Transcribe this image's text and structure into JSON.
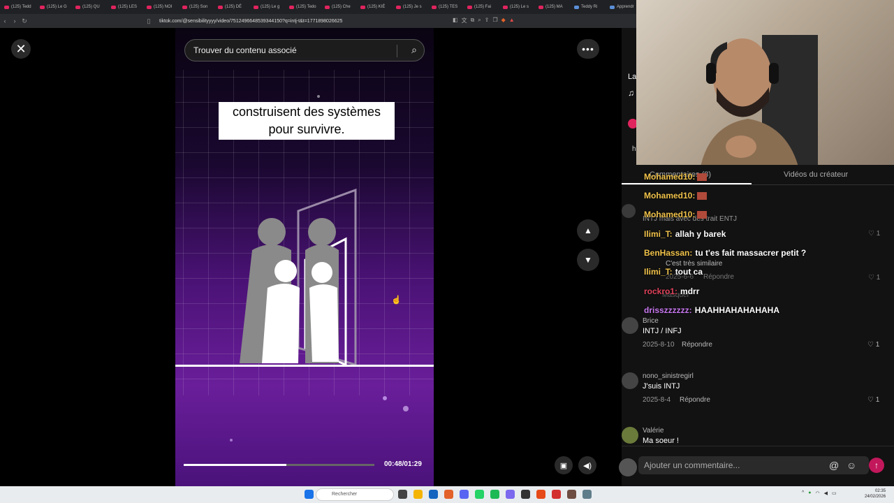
{
  "browser": {
    "tabs": [
      "(125) Tedd",
      "(125) Le G",
      "(125) QU",
      "(125) LES",
      "(125) NOI",
      "(125) Son",
      "(125) DÉ",
      "(125) Le g",
      "(125) Tedo",
      "(125) Che",
      "(125) KIÉ",
      "(125) Je s",
      "(125) TES",
      "(125) Fai",
      "(125) Le s",
      "(125) MA",
      "Teddy Ri",
      "Apprendr"
    ],
    "url": "tiktok.com/@sensibilityyyy/video/7512496648539344150?q=intj-t&t=1771898026625"
  },
  "video": {
    "search_placeholder": "Trouver du contenu associé",
    "caption": "construisent des systèmes pour survivre.",
    "progress": 0.54,
    "time": "00:48/01:29"
  },
  "comments_panel": {
    "tab_comments": "Commentaires (8)",
    "tab_creator": "Vidéos du créateur",
    "comments": [
      {
        "name": "Brice",
        "text": "INTJ / INFJ",
        "date": "2025-8-10",
        "reply": "Répondre",
        "likes": "1"
      },
      {
        "name": "nono_sinistregirl",
        "text": "J'suis INTJ",
        "date": "2025-8-4",
        "reply": "Répondre",
        "likes": "1"
      },
      {
        "name": "Valérie",
        "text": "Ma soeur !"
      }
    ],
    "faded": {
      "t1": "INTJ mais avec des trait ENTJ",
      "t2": "C'est très similaire",
      "t3": "2025-6-6",
      "t4": "Répondre",
      "t5": "Masquer",
      "like": "1"
    },
    "input_placeholder": "Ajouter un commentaire...",
    "side_snippets": {
      "a": "La",
      "b": "h"
    }
  },
  "stream_chat": [
    {
      "user": "Mohamed10:",
      "text": "",
      "color": "#f0c24a"
    },
    {
      "user": "Mohamed10:",
      "text": "",
      "color": "#f0c24a"
    },
    {
      "user": "Mohamed10:",
      "text": "",
      "color": "#f0c24a"
    },
    {
      "user": "Ilimi_T:",
      "text": "allah y barek",
      "color": "#f0c24a"
    },
    {
      "user": "BenHassan:",
      "text": "tu t'es fait massacrer petit ?",
      "color": "#f0c24a"
    },
    {
      "user": "Ilimi_T:",
      "text": "tout ca",
      "color": "#f0c24a"
    },
    {
      "user": "rockro1:",
      "text": "mdrr",
      "color": "#e0425a"
    },
    {
      "user": "drisszzzzzz:",
      "text": "HAAHHAHAHAHAHA",
      "color": "#c878f0"
    }
  ],
  "taskbar": {
    "search_placeholder": "Rechercher",
    "time": "02:35",
    "date": "24/02/2026"
  }
}
